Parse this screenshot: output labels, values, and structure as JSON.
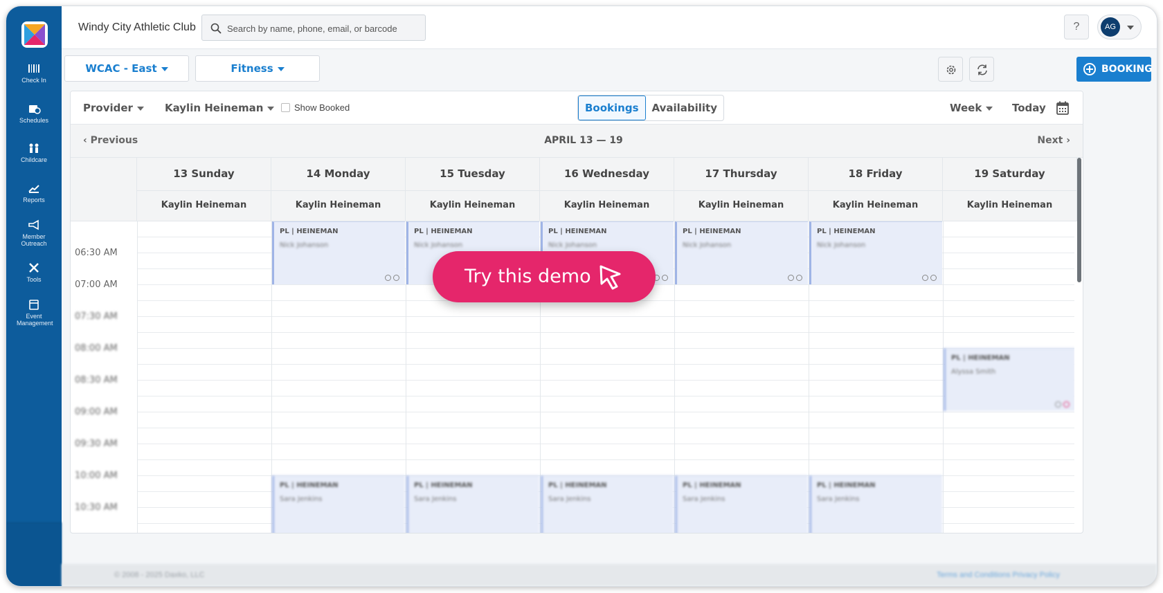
{
  "sidebar": {
    "items": [
      {
        "label": "Check In",
        "icon": "barcode-icon"
      },
      {
        "label": "Schedules",
        "icon": "calendar-clock-icon"
      },
      {
        "label": "Childcare",
        "icon": "people-icon"
      },
      {
        "label": "Reports",
        "icon": "chart-icon"
      },
      {
        "label": "Member Outreach",
        "icon": "megaphone-icon"
      },
      {
        "label": "Tools",
        "icon": "tools-icon"
      },
      {
        "label": "Event Management",
        "icon": "event-calendar-icon"
      }
    ]
  },
  "topbar": {
    "club_name": "Windy City Athletic Club",
    "search_placeholder": "Search by name, phone, email, or barcode",
    "help_label": "?",
    "user_initials": "AG"
  },
  "filters": {
    "location": "WCAC - East",
    "category": "Fitness",
    "booking_label": "BOOKING"
  },
  "toolbar": {
    "provider_label": "Provider",
    "provider_value": "Kaylin Heineman",
    "show_booked": "Show Booked",
    "tab_bookings": "Bookings",
    "tab_availability": "Availability",
    "view": "Week",
    "today": "Today"
  },
  "nav": {
    "previous": "Previous",
    "range": "APRIL 13 — 19",
    "next": "Next"
  },
  "days": [
    {
      "label": "13 Sunday",
      "provider": "Kaylin Heineman"
    },
    {
      "label": "14 Monday",
      "provider": "Kaylin Heineman"
    },
    {
      "label": "15 Tuesday",
      "provider": "Kaylin Heineman"
    },
    {
      "label": "16 Wednesday",
      "provider": "Kaylin Heineman"
    },
    {
      "label": "17 Thursday",
      "provider": "Kaylin Heineman"
    },
    {
      "label": "18 Friday",
      "provider": "Kaylin Heineman"
    },
    {
      "label": "19 Saturday",
      "provider": "Kaylin Heineman"
    }
  ],
  "times": [
    "06:30 AM",
    "07:00 AM",
    "07:30 AM",
    "08:00 AM",
    "08:30 AM",
    "09:00 AM",
    "09:30 AM",
    "10:00 AM",
    "10:30 AM"
  ],
  "events": {
    "early": {
      "title": "PL | HEINEMAN",
      "member": "Nick Johanson"
    },
    "saturday": {
      "title": "PL | HEINEMAN",
      "member": "Alyssa Smith"
    },
    "late": {
      "title": "PL | HEINEMAN",
      "member": "Sara Jenkins"
    }
  },
  "demo_label": "Try this demo",
  "footer": {
    "copyright": "© 2008 - 2025 Daxko, LLC",
    "links": "Terms and Conditions    Privacy Policy"
  },
  "colors": {
    "sidebar": "#0d5c9c",
    "accent": "#1a7fcf",
    "event_fill": "#e8edf9",
    "demo_button": "#e5266b"
  }
}
